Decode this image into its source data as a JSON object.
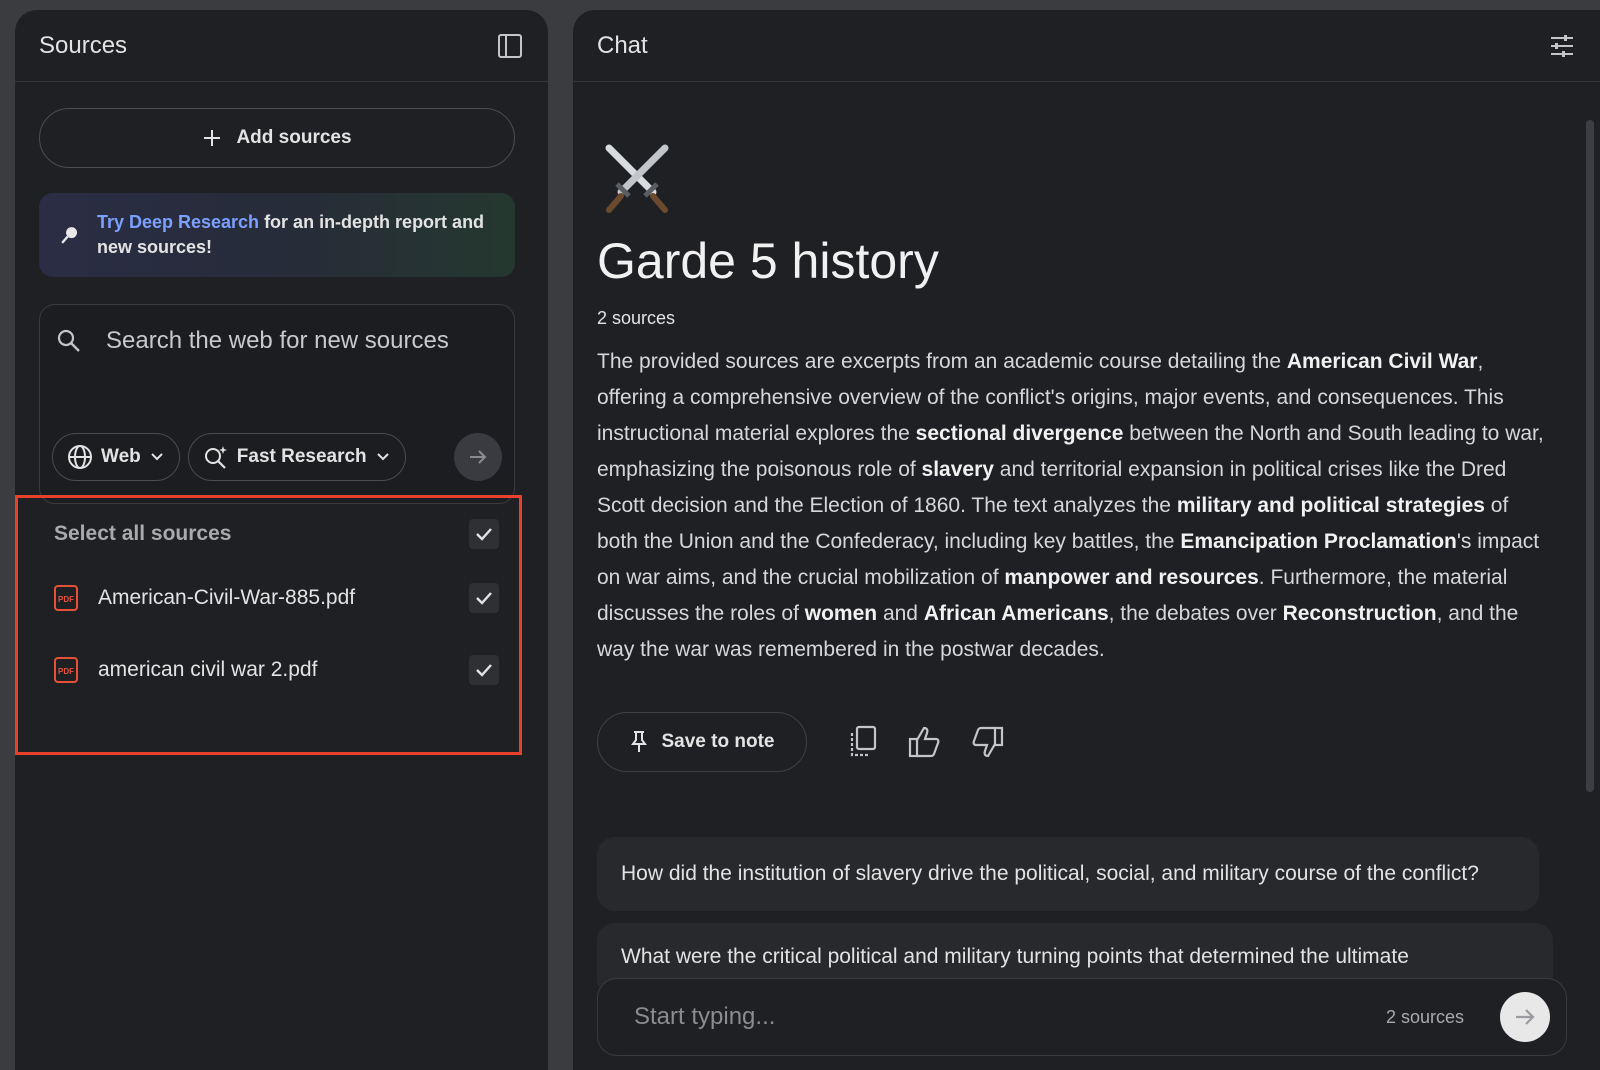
{
  "sources": {
    "title": "Sources",
    "add_label": "Add sources",
    "deep_research": {
      "link": "Try Deep Research",
      "text": " for an in-depth report and new sources!"
    },
    "search_placeholder": "Search the web for new sources",
    "web_chip": "Web",
    "research_chip": "Fast Research",
    "select_all": "Select all sources",
    "files": [
      {
        "name": "American-Civil-War-885.pdf",
        "checked": true
      },
      {
        "name": "american civil war 2.pdf",
        "checked": true
      }
    ]
  },
  "chat": {
    "title": "Chat",
    "emoji": "crossed-swords",
    "notebook_title": "Garde 5 history",
    "source_count": "2 sources",
    "summary": [
      {
        "t": "The provided sources are excerpts from an academic course detailing the "
      },
      {
        "t": "American Civil War",
        "b": true
      },
      {
        "t": ", offering a comprehensive overview of the conflict's origins, major events, and consequences. This instructional material explores the "
      },
      {
        "t": "sectional divergence",
        "b": true
      },
      {
        "t": " between the North and South leading to war, emphasizing the poisonous role of "
      },
      {
        "t": "slavery",
        "b": true
      },
      {
        "t": " and territorial expansion in political crises like the Dred Scott decision and the Election of 1860. The text analyzes the "
      },
      {
        "t": "military and political strategies",
        "b": true
      },
      {
        "t": " of both the Union and the Confederacy, including key battles, the "
      },
      {
        "t": "Emancipation Proclamation",
        "b": true
      },
      {
        "t": "'s impact on war aims, and the crucial mobilization of "
      },
      {
        "t": "manpower and resources",
        "b": true
      },
      {
        "t": ". Furthermore, the material discusses the roles of "
      },
      {
        "t": "women",
        "b": true
      },
      {
        "t": " and "
      },
      {
        "t": "African Americans",
        "b": true
      },
      {
        "t": ", the debates over "
      },
      {
        "t": "Reconstruction",
        "b": true
      },
      {
        "t": ", and the way the war was remembered in the postwar decades."
      }
    ],
    "save_note": "Save to note",
    "suggestions": [
      "How did the institution of slavery drive the political, social, and military course of the conflict?",
      "What were the critical political and military turning points that determined the ultimate"
    ],
    "composer_placeholder": "Start typing...",
    "composer_count": "2 sources"
  },
  "colors": {
    "panel_bg": "#1f2024",
    "highlight_border": "#e8402a",
    "link": "#7ca0ff",
    "pdf_icon": "#e8503a"
  }
}
